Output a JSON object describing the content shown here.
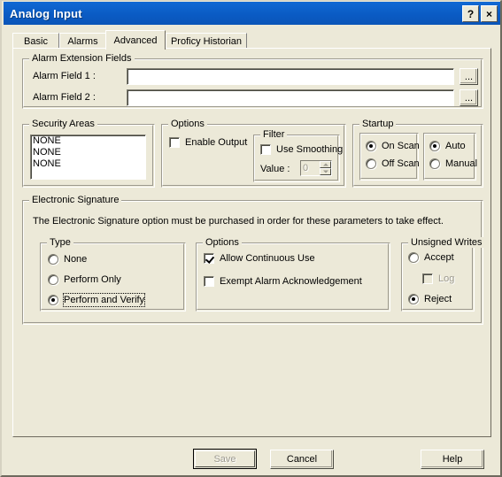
{
  "window": {
    "title": "Analog Input",
    "help_button": "?",
    "close_button": "×"
  },
  "tabs": [
    {
      "label": "Basic",
      "selected": false
    },
    {
      "label": "Alarms",
      "selected": false
    },
    {
      "label": "Advanced",
      "selected": true
    },
    {
      "label": "Proficy Historian",
      "selected": false
    }
  ],
  "alarm_extension_fields": {
    "title": "Alarm Extension Fields",
    "field1": {
      "label": "Alarm Field 1 :",
      "value": "",
      "browse_label": "..."
    },
    "field2": {
      "label": "Alarm Field 2 :",
      "value": "",
      "browse_label": "..."
    }
  },
  "security_areas": {
    "title": "Security Areas",
    "items": [
      "NONE",
      "NONE",
      "NONE"
    ]
  },
  "options": {
    "title": "Options",
    "enable_output": {
      "label": "Enable Output",
      "checked": false
    },
    "filter": {
      "title": "Filter",
      "use_smoothing": {
        "label": "Use Smoothing",
        "checked": false
      },
      "value_label": "Value :",
      "value": "0",
      "value_disabled": true
    }
  },
  "startup": {
    "title": "Startup",
    "scan": [
      {
        "label": "On Scan",
        "selected": true
      },
      {
        "label": "Off Scan",
        "selected": false
      }
    ],
    "mode": [
      {
        "label": "Auto",
        "selected": true
      },
      {
        "label": "Manual",
        "selected": false
      }
    ]
  },
  "electronic_signature": {
    "title": "Electronic Signature",
    "notice": "The Electronic Signature option must be purchased in order for these parameters to take effect.",
    "type": {
      "title": "Type",
      "items": [
        {
          "label": "None",
          "selected": false,
          "focused": false
        },
        {
          "label": "Perform Only",
          "selected": false,
          "focused": false
        },
        {
          "label": "Perform and Verify",
          "selected": true,
          "focused": true
        }
      ]
    },
    "options": {
      "title": "Options",
      "items": [
        {
          "label": "Allow Continuous Use",
          "checked": true,
          "disabled": false
        },
        {
          "label": "Exempt Alarm Acknowledgement",
          "checked": false,
          "disabled": false
        }
      ]
    },
    "unsigned_writes": {
      "title": "Unsigned Writes",
      "accept": {
        "label": "Accept",
        "selected": false
      },
      "log": {
        "label": "Log",
        "checked": false,
        "disabled": true
      },
      "reject": {
        "label": "Reject",
        "selected": true
      }
    }
  },
  "footer": {
    "save": {
      "label": "Save",
      "disabled": true,
      "default": true
    },
    "cancel": {
      "label": "Cancel",
      "disabled": false
    },
    "help": {
      "label": "Help",
      "disabled": false
    }
  },
  "colors": {
    "title_bar": "#0a5bc4",
    "dialog_face": "#ece9d8",
    "field_bg": "#ffffff",
    "disabled_text": "#9d9a8f"
  }
}
